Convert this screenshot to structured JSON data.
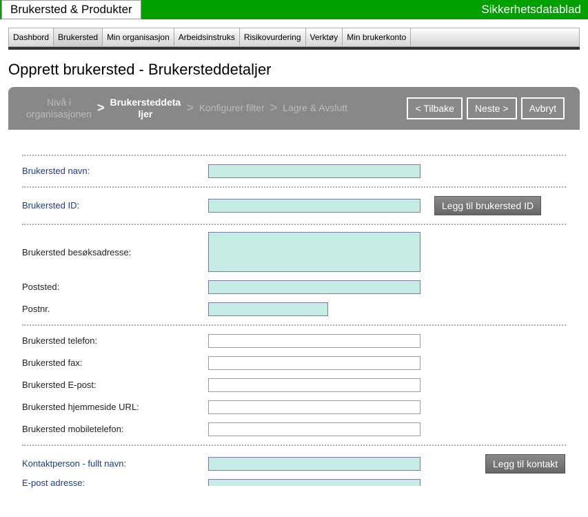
{
  "topbar": {
    "left": "Brukersted & Produkter",
    "right": "Sikkerhetsdatablad"
  },
  "menu": {
    "items": [
      "Dashbord",
      "Brukersted",
      "Min organisasjon",
      "Arbeidsinstruks",
      "Risikovurdering",
      "Verktøy",
      "Min brukerkonto"
    ],
    "active_index": 1
  },
  "page_title": "Opprett brukersted - Brukersteddetaljer",
  "wizard": {
    "steps": [
      "Nivå i\norganisasjonen",
      "Brukersteddeta\nljer",
      "Konfigurer filter",
      "Lagre & Avslutt"
    ],
    "active_index": 1,
    "back": "< Tilbake",
    "next": "Neste >",
    "cancel": "Avbryt"
  },
  "form": {
    "labels": {
      "navn": "Brukersted navn:",
      "id": "Brukersted ID:",
      "besok": "Brukersted besøksadresse:",
      "poststed": "Poststed:",
      "postnr": "Postnr.",
      "telefon": "Brukersted telefon:",
      "fax": "Brukersted fax:",
      "epost": "Brukersted E-post:",
      "url": "Brukersted hjemmeside URL:",
      "mobil": "Brukersted mobiletelefon:",
      "kontakt": "Kontaktperson - fullt navn:",
      "k_epost": "E-post adresse:"
    },
    "buttons": {
      "add_id": "Legg til brukersted ID",
      "add_contact": "Legg til kontakt"
    },
    "values": {
      "navn": "",
      "id": "",
      "besok": "",
      "poststed": "",
      "postnr": "",
      "telefon": "",
      "fax": "",
      "epost": "",
      "url": "",
      "mobil": "",
      "kontakt": "",
      "k_epost": ""
    }
  }
}
